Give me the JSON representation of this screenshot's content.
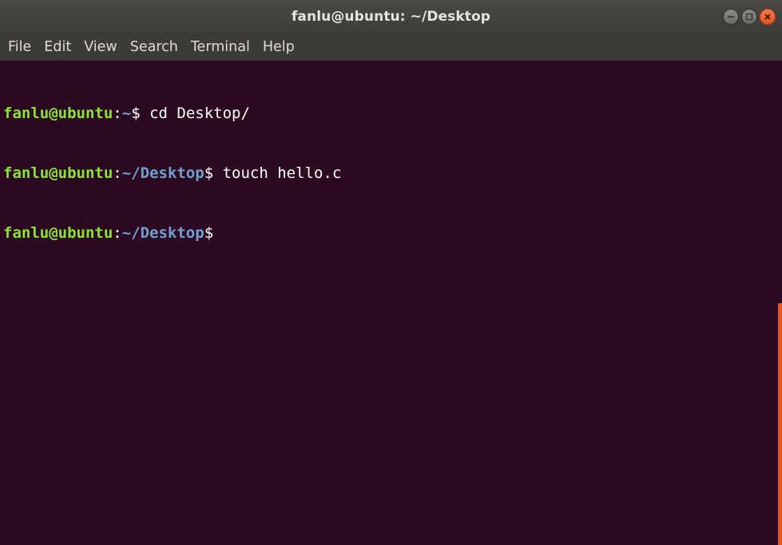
{
  "window": {
    "title": "fanlu@ubuntu: ~/Desktop",
    "controls": [
      "minimize-icon",
      "maximize-icon",
      "close-icon"
    ]
  },
  "menu": {
    "items": [
      {
        "label": "File"
      },
      {
        "label": "Edit"
      },
      {
        "label": "View"
      },
      {
        "label": "Search"
      },
      {
        "label": "Terminal"
      },
      {
        "label": "Help"
      }
    ]
  },
  "terminal": {
    "lines": [
      {
        "user": "fanlu@ubuntu",
        "colon": ":",
        "path": "~",
        "sym": "$",
        "cmd": " cd Desktop/"
      },
      {
        "user": "fanlu@ubuntu",
        "colon": ":",
        "path": "~/Desktop",
        "sym": "$",
        "cmd": " touch hello.c"
      },
      {
        "user": "fanlu@ubuntu",
        "colon": ":",
        "path": "~/Desktop",
        "sym": "$",
        "cmd": ""
      }
    ]
  },
  "colors": {
    "background": "#2c0a22",
    "user": "#8ae234",
    "path": "#729fcf",
    "accent": "#e05a2b"
  }
}
